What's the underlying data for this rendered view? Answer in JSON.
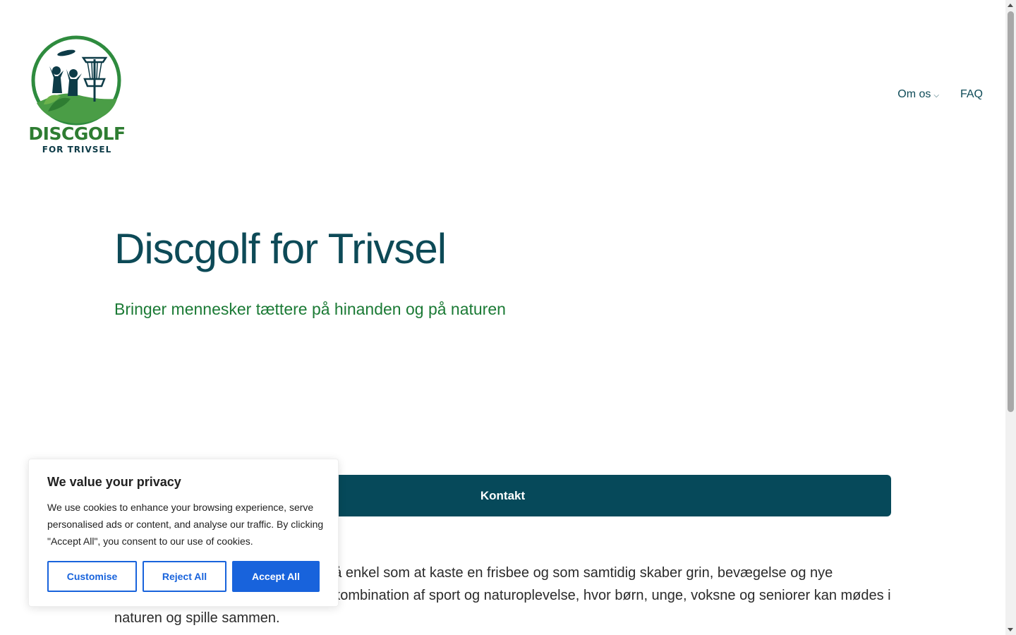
{
  "header": {
    "logo_line1": "DISCGOLF",
    "logo_line2": "FOR TRIVSEL",
    "nav": [
      {
        "label": "Om os",
        "has_dropdown": true
      },
      {
        "label": "FAQ",
        "has_dropdown": false
      }
    ]
  },
  "hero": {
    "title": "Discgolf for Trivsel",
    "subtitle": "Bringer mennesker tættere på hinanden og på naturen",
    "cta_label": "Kontakt"
  },
  "intro": {
    "text": "Discgolf er en aktivitet, der er lige så enkel som at kaste en frisbee og som samtidig skaber grin, bevægelse og nye venskaber. Det er en inkluderende kombination af sport og naturoplevelse, hvor børn, unge, voksne og seniorer kan mødes i naturen og spille sammen."
  },
  "cookie_banner": {
    "title": "We value your privacy",
    "text": "We use cookies to enhance your browsing experience, serve personalised ads or content, and analyse our traffic. By clicking \"Accept All\", you consent to our use of cookies.",
    "buttons": {
      "customise": "Customise",
      "reject": "Reject All",
      "accept": "Accept All"
    }
  },
  "colors": {
    "brand_dark": "#06495a",
    "brand_green": "#1b7a35",
    "cookie_blue": "#1863dc"
  }
}
